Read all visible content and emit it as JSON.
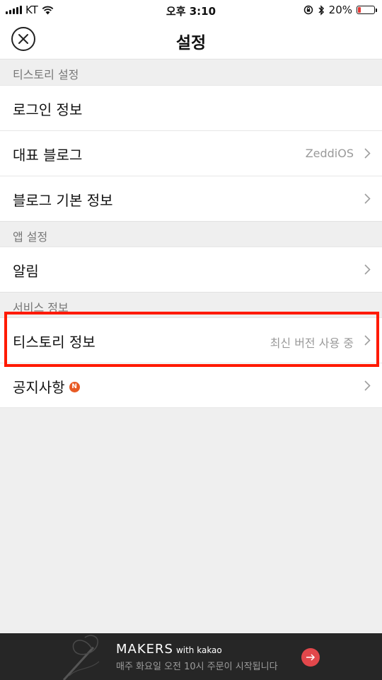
{
  "status_bar": {
    "carrier": "KT",
    "time": "오후 3:10",
    "battery_percent": "20%",
    "battery_level": 0.2
  },
  "nav": {
    "title": "설정",
    "close_icon": "close-circle-icon"
  },
  "sections": [
    {
      "header": "티스토리 설정",
      "rows": [
        {
          "label": "로그인 정보",
          "value": "",
          "chevron": false
        },
        {
          "label": "대표 블로그",
          "value": "ZeddiOS",
          "chevron": true
        },
        {
          "label": "블로그 기본 정보",
          "value": "",
          "chevron": true
        }
      ]
    },
    {
      "header": "앱 설정",
      "rows": [
        {
          "label": "알림",
          "value": "",
          "chevron": true
        }
      ]
    },
    {
      "header": "서비스 정보",
      "rows": [
        {
          "label": "티스토리 정보",
          "value": "최신 버전 사용 중",
          "chevron": true,
          "highlighted": true
        },
        {
          "label": "공지사항",
          "value": "",
          "chevron": true,
          "badge": "N"
        }
      ]
    }
  ],
  "banner": {
    "brand": "MAKERS",
    "brand_suffix": "with kakao",
    "subtitle": "매주 화요일 오전 10시 주문이 시작됩니다",
    "action_icon": "arrow-right-icon"
  },
  "colors": {
    "highlight": "#ff1a00",
    "badge": "#e85a24",
    "banner_action": "#e2474b",
    "battery_low": "#e53935"
  }
}
